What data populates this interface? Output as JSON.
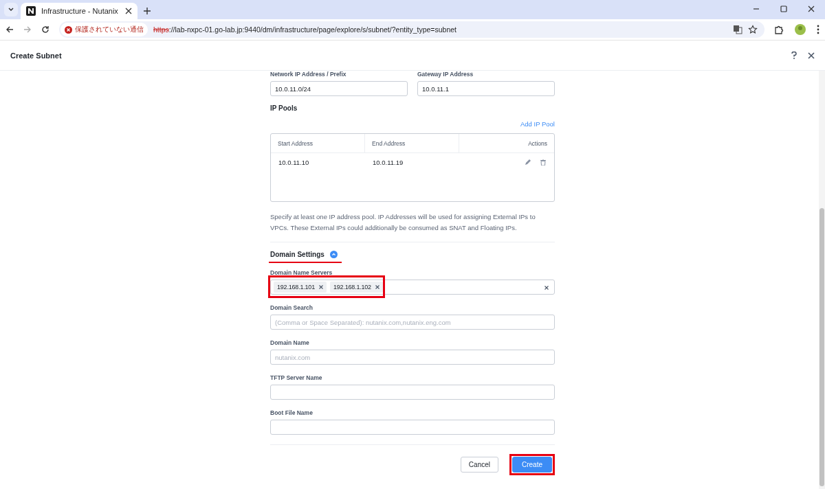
{
  "browser": {
    "tab": {
      "title": "Infrastructure - Nutanix",
      "selected": true
    },
    "security_chip": "保護されていない通信",
    "url_scheme": "https",
    "url_rest": "://lab-nxpc-01.go-lab.jp:9440/dm/infrastructure/page/explore/s/subnet/?entity_type=subnet"
  },
  "modal": {
    "title": "Create Subnet"
  },
  "network": {
    "fields": [
      {
        "label": "Network IP Address / Prefix",
        "value": "10.0.11.0/24"
      },
      {
        "label": "Gateway IP Address",
        "value": "10.0.11.1"
      }
    ]
  },
  "ip_pools": {
    "title": "IP Pools",
    "add_link": "Add IP Pool",
    "columns": [
      "Start Address",
      "End Address",
      "Actions"
    ],
    "rows": [
      {
        "start": "10.0.11.10",
        "end": "10.0.11.19"
      }
    ],
    "help": "Specify at least one IP address pool. IP Addresses will be used for assigning External IPs to VPCs. These External IPs could additionally be consumed as SNAT and Floating IPs."
  },
  "domain_settings": {
    "title": "Domain Settings",
    "expanded": true,
    "underlined": true,
    "fields": [
      {
        "kind": "tags",
        "label": "Domain Name Servers",
        "tags": [
          "192.168.1.101",
          "192.168.1.102"
        ],
        "highlighted": true
      },
      {
        "kind": "text",
        "label": "Domain Search",
        "placeholder": "(Comma or Space Separated): nutanix.com,nutanix.eng.com"
      },
      {
        "kind": "text",
        "label": "Domain Name",
        "placeholder": "nutanix.com"
      },
      {
        "kind": "text",
        "label": "TFTP Server Name"
      },
      {
        "kind": "text",
        "label": "Boot File Name"
      }
    ]
  },
  "buttons": [
    {
      "label": "Cancel",
      "kind": "secondary",
      "highlighted": false
    },
    {
      "label": "Create",
      "kind": "primary",
      "highlighted": true
    }
  ]
}
